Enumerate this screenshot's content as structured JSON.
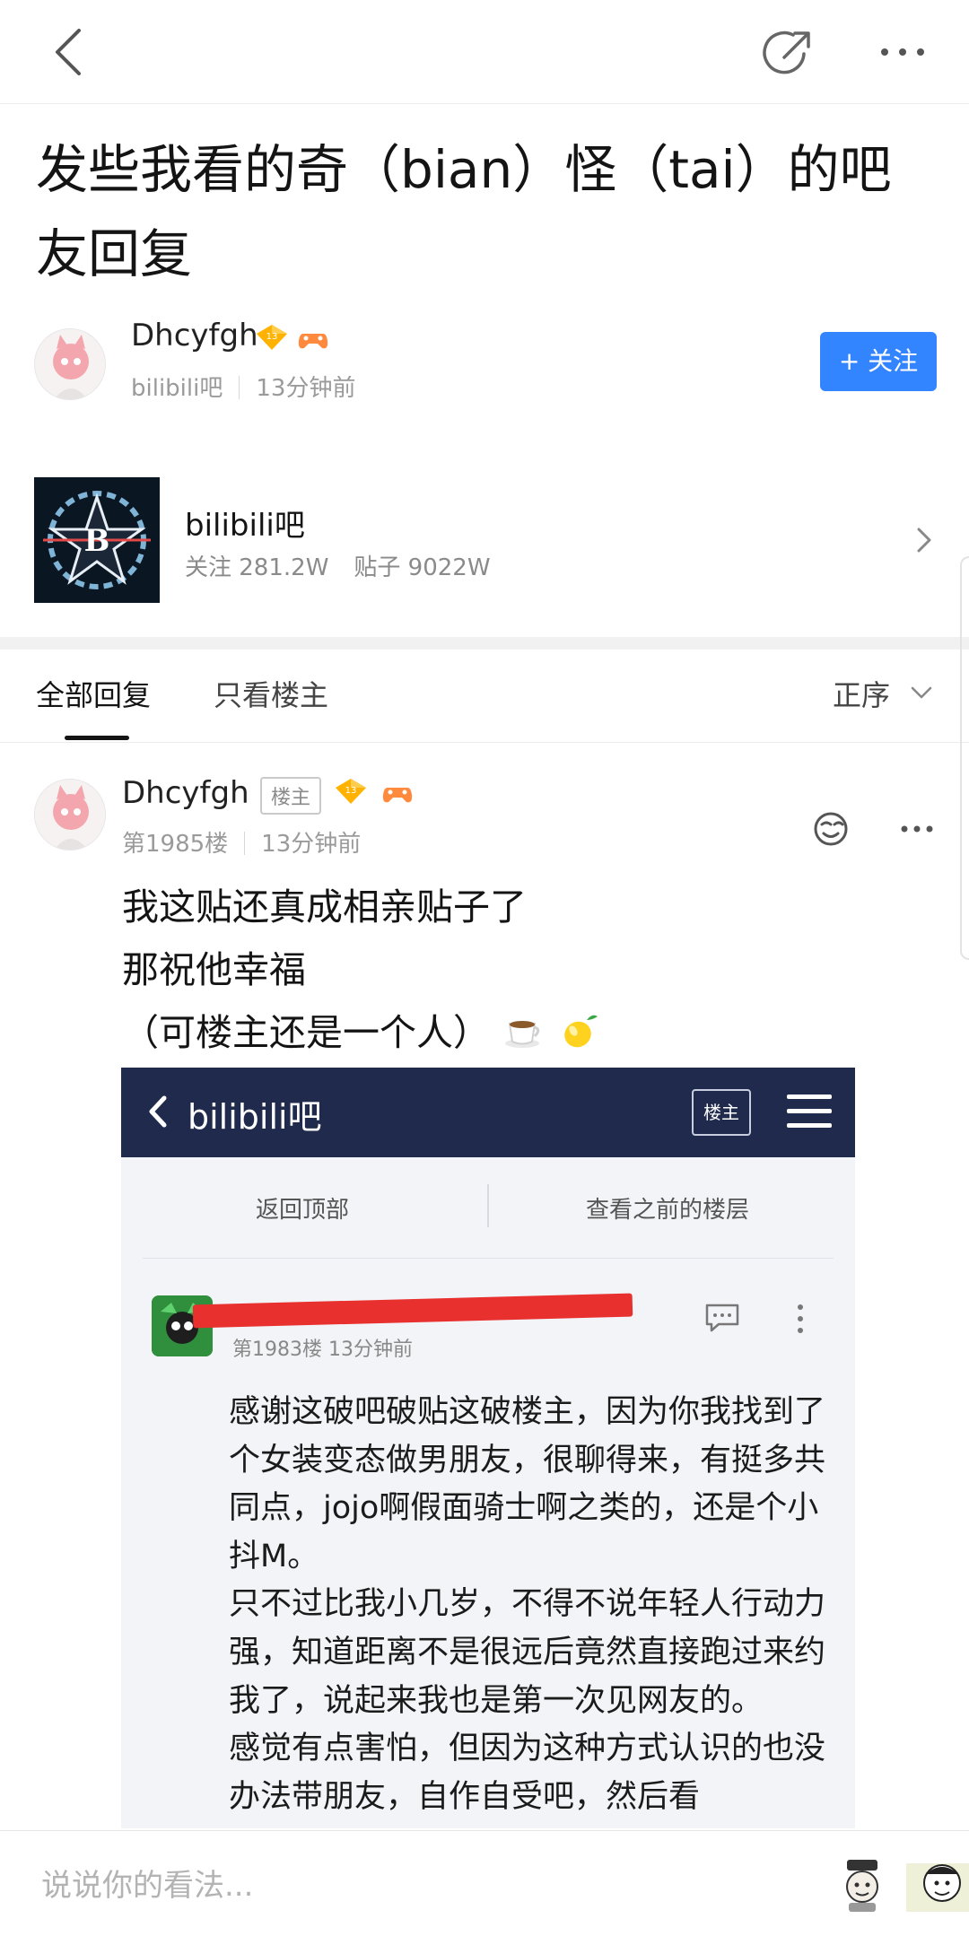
{
  "post": {
    "title": "发些我看的奇（bian）怪（tai）的吧友回复"
  },
  "author": {
    "name": "Dhcyfgh",
    "forum": "bilibili吧",
    "time": "13分钟前",
    "level": "13",
    "follow_label": "+ 关注"
  },
  "forum": {
    "name": "bilibili吧",
    "followers": "关注 281.2W",
    "posts": "贴子 9022W"
  },
  "tabs": {
    "all": "全部回复",
    "owner_only": "只看楼主",
    "sort": "正序"
  },
  "reply": {
    "name": "Dhcyfgh",
    "owner_tag": "楼主",
    "floor": "第1985楼",
    "time": "13分钟前",
    "line1": "我这贴还真成相亲贴子了",
    "line2": "那祝他幸福",
    "line3": "（可楼主还是一个人）"
  },
  "screenshot": {
    "nav_title": "bilibili吧",
    "owner_btn": "楼主",
    "back_top": "返回顶部",
    "prev_floors": "查看之前的楼层",
    "floor_meta": "第1983楼  13分钟前",
    "text": "感谢这破吧破贴这破楼主，因为你我找到了个女装变态做男朋友，很聊得来，有挺多共同点，jojo啊假面骑士啊之类的，还是个小抖M。\n只不过比我小几岁，不得不说年轻人行动力强，知道距离不是很远后竟然直接跑过来约我了，说起来我也是第一次见网友的。\n感觉有点害怕，但因为这种方式认识的也没办法带朋友，自作自受吧，然后看"
  },
  "bottom": {
    "placeholder": "说说你的看法..."
  },
  "colors": {
    "accent": "#3385ff",
    "screenshot_nav": "#1f2a4d",
    "redaction": "#e8302f"
  },
  "icons": {
    "back": "chevron-left-icon",
    "share": "share-icon",
    "more": "more-dots-icon",
    "level": "diamond-badge-icon",
    "game": "gamepad-badge-icon",
    "face": "face-icon",
    "sort": "chevron-down-icon",
    "forum_go": "chevron-right-icon"
  }
}
